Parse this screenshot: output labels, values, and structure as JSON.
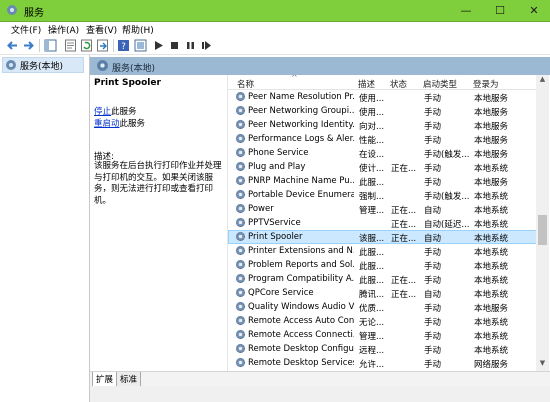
{
  "window": {
    "title": "服务"
  },
  "title_controls": {
    "minimize": "—",
    "maximize": "☐",
    "close": "✕"
  },
  "menu": [
    "文件(F)",
    "操作(A)",
    "查看(V)",
    "帮助(H)"
  ],
  "toolbar": [
    "back-icon",
    "forward-icon",
    "console-tree-icon",
    "properties-view-icon",
    "refresh-icon",
    "export-icon",
    "help-icon",
    "panel-icon",
    "play-icon",
    "stop-icon",
    "pause-icon",
    "restart-icon"
  ],
  "tree": {
    "root_label": "服务(本地)"
  },
  "panel": {
    "header": "服务(本地)"
  },
  "details": {
    "service_name": "Print Spooler",
    "stop_link": "停止",
    "stop_suffix": "此服务",
    "restart_link": "重启动",
    "restart_suffix": "此服务",
    "desc_label": "描述:",
    "desc_text": "该服务在后台执行打印作业并处理与打印机的交互。如果关闭该服务，则无法进行打印或查看打印机。"
  },
  "list": {
    "columns": {
      "name": "名称",
      "description": "描述",
      "status": "状态",
      "startup": "启动类型",
      "logon": "登录为"
    },
    "sort_indicator": "^",
    "rows": [
      {
        "name": "Peer Name Resolution Pr...",
        "description": "使用...",
        "status": "",
        "startup": "手动",
        "logon": "本地服务"
      },
      {
        "name": "Peer Networking Groupi...",
        "description": "使用...",
        "status": "",
        "startup": "手动",
        "logon": "本地服务"
      },
      {
        "name": "Peer Networking Identity...",
        "description": "向对...",
        "status": "",
        "startup": "手动",
        "logon": "本地服务"
      },
      {
        "name": "Performance Logs & Aler...",
        "description": "性能...",
        "status": "",
        "startup": "手动",
        "logon": "本地服务"
      },
      {
        "name": "Phone Service",
        "description": "在设...",
        "status": "",
        "startup": "手动(触发...",
        "logon": "本地服务"
      },
      {
        "name": "Plug and Play",
        "description": "使计...",
        "status": "正在...",
        "startup": "手动",
        "logon": "本地系统"
      },
      {
        "name": "PNRP Machine Name Pu...",
        "description": "此服...",
        "status": "",
        "startup": "手动",
        "logon": "本地服务"
      },
      {
        "name": "Portable Device Enumera...",
        "description": "强制...",
        "status": "",
        "startup": "手动(触发...",
        "logon": "本地系统"
      },
      {
        "name": "Power",
        "description": "管理...",
        "status": "正在...",
        "startup": "自动",
        "logon": "本地系统"
      },
      {
        "name": "PPTVService",
        "description": "",
        "status": "正在...",
        "startup": "自动(延迟...",
        "logon": "本地系统"
      },
      {
        "name": "Print Spooler",
        "description": "该服...",
        "status": "正在...",
        "startup": "自动",
        "logon": "本地系统",
        "selected": true
      },
      {
        "name": "Printer Extensions and N...",
        "description": "此服...",
        "status": "",
        "startup": "手动",
        "logon": "本地系统"
      },
      {
        "name": "Problem Reports and Sol...",
        "description": "此服...",
        "status": "",
        "startup": "手动",
        "logon": "本地系统"
      },
      {
        "name": "Program Compatibility A...",
        "description": "此服...",
        "status": "正在...",
        "startup": "手动",
        "logon": "本地系统"
      },
      {
        "name": "QPCore Service",
        "description": "腾讯...",
        "status": "正在...",
        "startup": "自动",
        "logon": "本地系统"
      },
      {
        "name": "Quality Windows Audio V...",
        "description": "优质...",
        "status": "",
        "startup": "手动",
        "logon": "本地服务"
      },
      {
        "name": "Remote Access Auto Con...",
        "description": "无论...",
        "status": "",
        "startup": "手动",
        "logon": "本地系统"
      },
      {
        "name": "Remote Access Connecti...",
        "description": "管理...",
        "status": "",
        "startup": "手动",
        "logon": "本地系统"
      },
      {
        "name": "Remote Desktop Configu...",
        "description": "远程...",
        "status": "",
        "startup": "手动",
        "logon": "本地系统"
      },
      {
        "name": "Remote Desktop Services",
        "description": "允许...",
        "status": "",
        "startup": "手动",
        "logon": "网络服务"
      }
    ]
  },
  "scroll": {
    "up": "▲",
    "down": "▼"
  },
  "tabs": [
    "扩展",
    "标准"
  ]
}
